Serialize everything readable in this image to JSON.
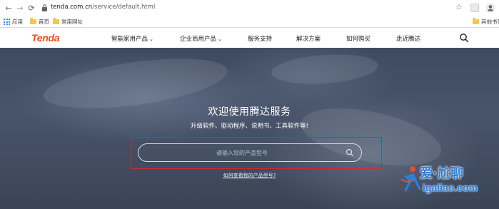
{
  "browser": {
    "url_host": "tenda.com.cn",
    "url_path": "/service/default.html",
    "bookmarks": [
      {
        "label": "应用",
        "icon": "apps-icon"
      },
      {
        "label": "首页",
        "icon": "folder-icon"
      },
      {
        "label": "常用网址",
        "icon": "folder-icon"
      }
    ],
    "bookmark_right": "其他书签"
  },
  "site": {
    "logo": "Tenda",
    "nav": [
      {
        "label": "智能家用产品",
        "dropdown": true
      },
      {
        "label": "企业商用产品",
        "dropdown": true
      },
      {
        "label": "服务支持",
        "dropdown": false
      },
      {
        "label": "解决方案",
        "dropdown": false
      },
      {
        "label": "如何购买",
        "dropdown": false
      },
      {
        "label": "走近腾达",
        "dropdown": false
      }
    ]
  },
  "hero": {
    "title": "欢迎使用腾达服务",
    "subtitle": "升级软件、驱动程序、说明书、工具软件等!",
    "search_placeholder": "请输入您的产品型号",
    "help_link": "如何查看我的产品型号?"
  },
  "watermark": {
    "text": "爱·尬聊",
    "sub": "igaliao.com"
  },
  "colors": {
    "brand": "#e8501f",
    "highlight": "#d9262c",
    "watermark": "#2f7fd6"
  }
}
